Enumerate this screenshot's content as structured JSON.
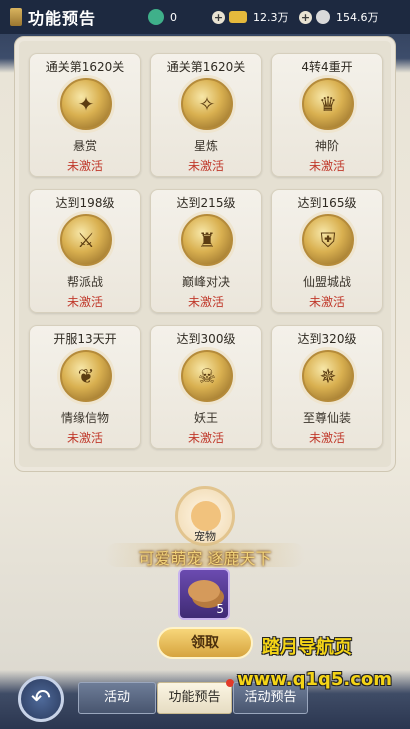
{
  "header": {
    "title": "功能预告"
  },
  "resources": [
    {
      "icon": "green-jade-icon",
      "value": "0",
      "color": "#3fb08a"
    },
    {
      "icon": "gold-ingot-icon",
      "value": "12.3万",
      "color": "#e5b93c"
    },
    {
      "icon": "silver-coin-icon",
      "value": "154.6万",
      "color": "#d9d9d9"
    }
  ],
  "features": [
    {
      "requirement": "通关第1620关",
      "name": "悬赏",
      "status": "未激活",
      "glyph": "✦"
    },
    {
      "requirement": "通关第1620关",
      "name": "星炼",
      "status": "未激活",
      "glyph": "✧"
    },
    {
      "requirement": "4转4重开",
      "name": "神阶",
      "status": "未激活",
      "glyph": "♛"
    },
    {
      "requirement": "达到198级",
      "name": "帮派战",
      "status": "未激活",
      "glyph": "⚔"
    },
    {
      "requirement": "达到215级",
      "name": "巅峰对决",
      "status": "未激活",
      "glyph": "♜"
    },
    {
      "requirement": "达到165级",
      "name": "仙盟城战",
      "status": "未激活",
      "glyph": "⛨"
    },
    {
      "requirement": "开服13天开",
      "name": "情缘信物",
      "status": "未激活",
      "glyph": "❦"
    },
    {
      "requirement": "达到300级",
      "name": "妖王",
      "status": "未激活",
      "glyph": "☠"
    },
    {
      "requirement": "达到320级",
      "name": "至尊仙装",
      "status": "未激活",
      "glyph": "✵"
    }
  ],
  "pet": {
    "label": "宠物",
    "slogan": "可爱萌宠  逐鹿天下"
  },
  "reward": {
    "quantity": "5",
    "claim_label": "领取"
  },
  "watermark": {
    "line1": "踏月导航页",
    "line2": "www.q1q5.com"
  },
  "tabs": [
    {
      "label": "活动",
      "active": false
    },
    {
      "label": "功能预告",
      "active": true
    },
    {
      "label": "活动预告",
      "active": false
    }
  ]
}
